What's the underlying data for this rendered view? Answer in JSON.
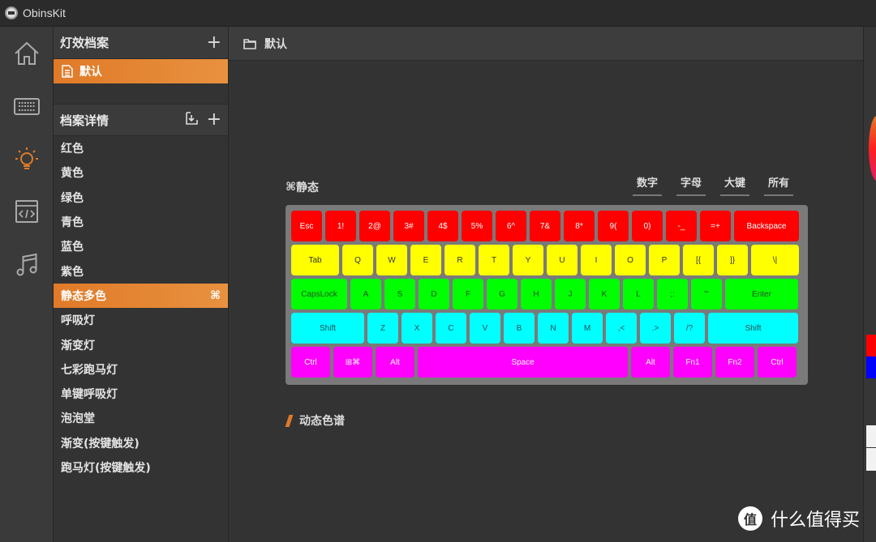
{
  "app": {
    "title": "ObinsKit"
  },
  "nav": [
    {
      "name": "home",
      "icon": "home-icon",
      "active": false
    },
    {
      "name": "keyboard",
      "icon": "keyboard-icon",
      "active": false
    },
    {
      "name": "lighting",
      "icon": "lightbulb-icon",
      "active": true
    },
    {
      "name": "macro",
      "icon": "code-window-icon",
      "active": false
    },
    {
      "name": "music",
      "icon": "music-note-icon",
      "active": false
    }
  ],
  "profiles": {
    "header": "灯效档案",
    "add_icon": "+",
    "selected": "默认"
  },
  "details": {
    "header": "档案详情",
    "add_icon": "+",
    "items": [
      {
        "label": "红色"
      },
      {
        "label": "黄色"
      },
      {
        "label": "绿色"
      },
      {
        "label": "青色"
      },
      {
        "label": "蓝色"
      },
      {
        "label": "紫色"
      },
      {
        "label": "静态多色",
        "active": true,
        "badge": "⌘"
      },
      {
        "label": "呼吸灯"
      },
      {
        "label": "渐变灯"
      },
      {
        "label": "七彩跑马灯"
      },
      {
        "label": "单键呼吸灯"
      },
      {
        "label": "泡泡堂"
      },
      {
        "label": "渐变(按键触发)"
      },
      {
        "label": "跑马灯(按键触发)"
      }
    ]
  },
  "main": {
    "header": "默认",
    "section_title": "静态",
    "section_icon": "⌘",
    "filters": [
      "数字",
      "字母",
      "大键",
      "所有"
    ],
    "dynamic_title": "动态色谱"
  },
  "keyboard": {
    "colors": {
      "row0": "#ff0000",
      "row1": "#ffff00",
      "row2": "#00ff00",
      "row3": "#00ffff",
      "row4": "#ff00ff"
    },
    "rows": [
      [
        "Esc",
        "1!",
        "2@",
        "3#",
        "4$",
        "5%",
        "6^",
        "7&",
        "8*",
        "9(",
        "0)",
        "-_",
        "=+",
        "Backspace"
      ],
      [
        "Tab",
        "Q",
        "W",
        "E",
        "R",
        "T",
        "Y",
        "U",
        "I",
        "O",
        "P",
        "[{",
        "]}",
        "\\|"
      ],
      [
        "CapsLock",
        "A",
        "S",
        "D",
        "F",
        "G",
        "H",
        "J",
        "K",
        "L",
        ";:",
        "'\"",
        "Enter"
      ],
      [
        "Shift",
        "Z",
        "X",
        "C",
        "V",
        "B",
        "N",
        "M",
        ",<",
        ".>",
        "/?",
        "Shift"
      ],
      [
        "Ctrl",
        "⊞⌘",
        "Alt",
        "Space",
        "Alt",
        "Fn1",
        "Fn2",
        "Ctrl"
      ]
    ]
  },
  "watermark": {
    "badge": "值",
    "text": "什么值得买"
  }
}
